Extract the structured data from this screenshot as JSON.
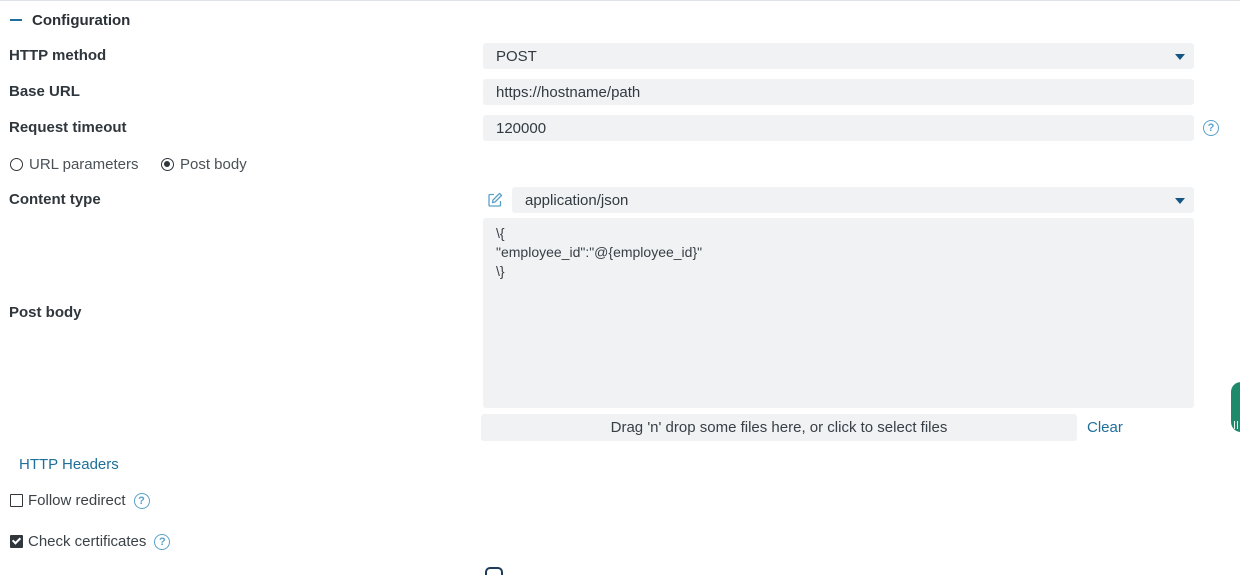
{
  "section": {
    "title": "Configuration"
  },
  "fields": {
    "http_method": {
      "label": "HTTP method",
      "value": "POST"
    },
    "base_url": {
      "label": "Base URL",
      "value": "https://hostname/path"
    },
    "request_timeout": {
      "label": "Request timeout",
      "value": "120000"
    },
    "content_type": {
      "label": "Content type",
      "value": "application/json"
    },
    "post_body": {
      "label": "Post body",
      "value": "\\{\n\"employee_id\":\"@{employee_id}\"\n\\}"
    }
  },
  "param_mode": {
    "options": [
      {
        "label": "URL parameters",
        "selected": false
      },
      {
        "label": "Post body",
        "selected": true
      }
    ]
  },
  "dropzone": {
    "text": "Drag 'n' drop some files here, or click to select files",
    "clear_label": "Clear"
  },
  "http_headers_label": "HTTP Headers",
  "follow_redirect": {
    "label": "Follow redirect",
    "checked": false
  },
  "check_certificates": {
    "label": "Check certificates",
    "checked": true
  },
  "icons": {
    "help": "?",
    "edit": "edit-icon",
    "dropdown": "chevron-down-icon"
  },
  "colors": {
    "accent": "#1e6f9a",
    "field_bg": "#f0f2f4",
    "widget": "#1f8a6b"
  }
}
